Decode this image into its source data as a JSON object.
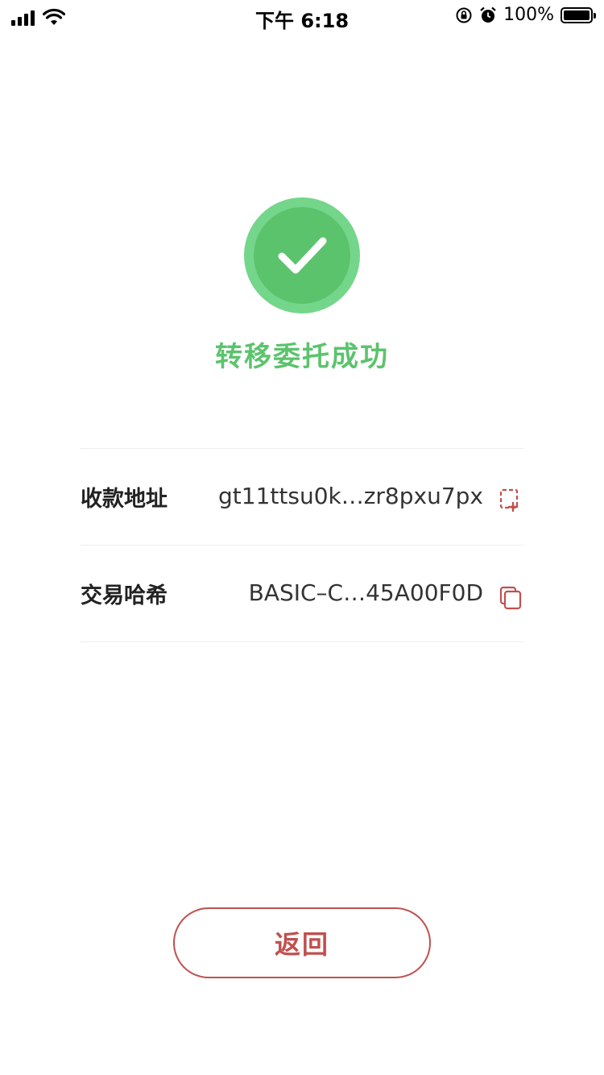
{
  "status_bar": {
    "time": "下午 6:18",
    "battery_percent": "100%",
    "battery_level": 1.0
  },
  "result": {
    "title": "转移委托成功",
    "icon": "check-circle-icon",
    "color": "#5cc36d"
  },
  "details": [
    {
      "label": "收款地址",
      "value": "gt11ttsu0k…zr8pxu7px",
      "icon": "copy-icon"
    },
    {
      "label": "交易哈希",
      "value": "BASIC–C…45A00F0D",
      "icon": "copy-icon"
    }
  ],
  "actions": {
    "back_label": "返回",
    "accent_color": "#c0504f"
  }
}
